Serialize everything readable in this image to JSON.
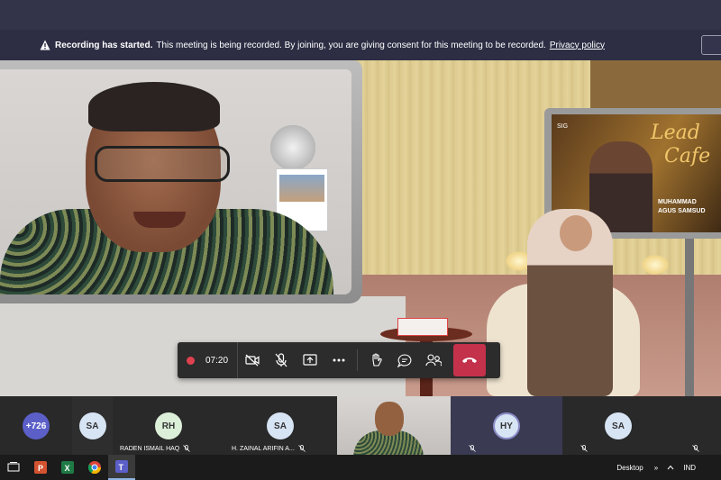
{
  "banner": {
    "title": "Recording has started.",
    "message": "This meeting is being recorded. By joining, you are giving consent for this meeting to be recorded.",
    "privacy_link": "Privacy policy"
  },
  "stage": {
    "tv_screen_title_line1": "Lead",
    "tv_screen_title_line2": "Cafe",
    "tv_logo": "SIG",
    "tv_name_line1": "MUHAMMAD",
    "tv_name_line2": "AGUS SAMSUD"
  },
  "controls": {
    "timer": "07:20",
    "icons": [
      "record-icon",
      "camera-off-icon",
      "mic-off-icon",
      "share-screen-icon",
      "more-icon",
      "raise-hand-icon",
      "chat-icon",
      "participants-icon",
      "hang-up-icon"
    ],
    "hangup_color": "#c4314b"
  },
  "participants": [
    {
      "initials": "+726",
      "name": "",
      "bg": "#5b5fc7",
      "fg": "#ffffff"
    },
    {
      "initials": "SA",
      "name": "",
      "bg": "#d7e4f4",
      "fg": "#333333"
    },
    {
      "initials": "RH",
      "name": "RADEN ISMAIL HAQ",
      "bg": "#dcefd8",
      "fg": "#333333"
    },
    {
      "initials": "SA",
      "name": "H. ZAINAL ARIFIN A...",
      "bg": "#d7e4f4",
      "fg": "#333333"
    },
    {
      "initials": "HY",
      "name": "",
      "bg": "#d7e4f4",
      "fg": "#333333"
    },
    {
      "initials": "SA",
      "name": "",
      "bg": "#d7e4f4",
      "fg": "#333333"
    }
  ],
  "taskbar": {
    "apps": [
      "task-view-icon",
      "powerpoint-icon",
      "excel-icon",
      "chrome-icon",
      "teams-icon"
    ],
    "desktop_label": "Desktop",
    "language": "IND",
    "overflow": "»"
  }
}
